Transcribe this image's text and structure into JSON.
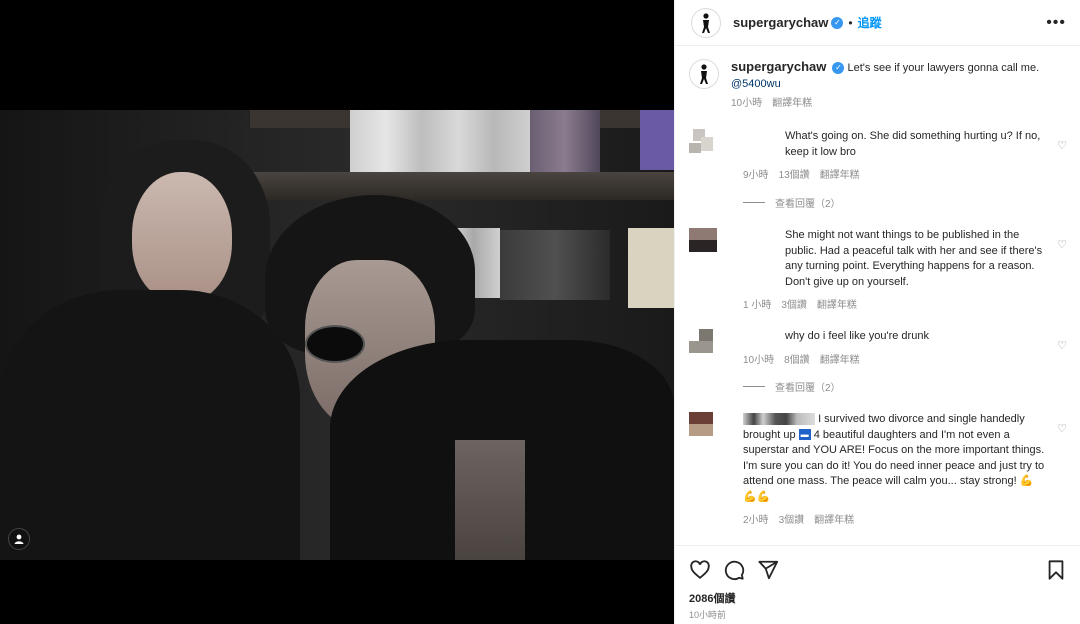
{
  "post": {
    "username": "supergarychaw",
    "follow_label": "追蹤",
    "more_label": "•••",
    "dot": "•",
    "caption_username": "supergarychaw",
    "caption_text": "Let's see if your lawyers gonna call me.",
    "caption_mention": "@5400wu",
    "caption_time": "10小時",
    "translate": "翻譯年糕",
    "likes": "2086個讚",
    "posted_ago": "10小時前"
  },
  "comments": [
    {
      "text": "What's going on. She did something hurting u? If no, keep it low bro",
      "time": "9小時",
      "likes": "13個讚",
      "translate": "翻譯年糕",
      "replies": "查看回覆（2）"
    },
    {
      "text": "She might not want things to be published in the public. Had a peaceful talk with her and see if there's any turning point. Everything happens for a reason. Don't give up on yourself.",
      "time": "1 小時",
      "likes": "3個讚",
      "translate": "翻譯年糕"
    },
    {
      "text": "why do i feel like you're drunk",
      "time": "10小時",
      "likes": "8個讚",
      "translate": "翻譯年糕",
      "replies": "查看回覆（2）"
    },
    {
      "text_a": "I survived two divorce and single handedly",
      "text_b": "brought up",
      "text_c": "4 beautiful daughters and I'm not even a superstar and YOU ARE! Focus on the more important things. I'm sure you can do it! You do need inner peace and just try to attend one mass. The peace will calm you... stay strong!",
      "emoji": "💪💪💪",
      "time": "2小時",
      "likes": "3個讚",
      "translate": "翻譯年糕"
    }
  ],
  "icons": {
    "heart": "heart-icon",
    "comment": "comment-icon",
    "share": "share-icon",
    "bookmark": "bookmark-icon",
    "verified": "verified-badge-icon",
    "tag": "user-tag-icon"
  },
  "colors": {
    "accent": "#0095f6",
    "verified": "#3897f0",
    "muted": "#8e8e8e"
  }
}
